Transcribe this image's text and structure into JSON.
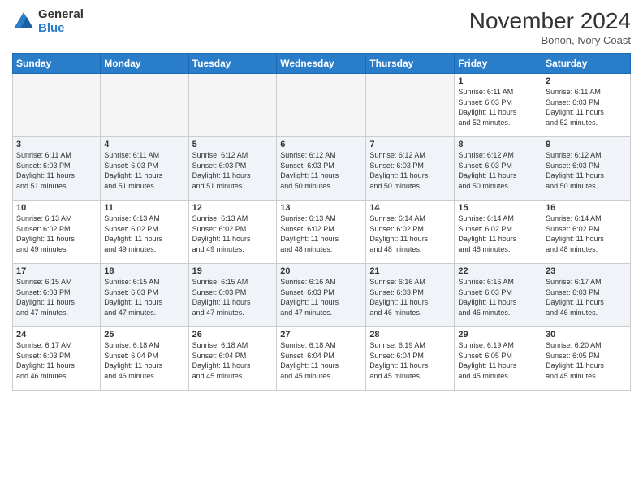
{
  "app": {
    "logo_general": "General",
    "logo_blue": "Blue"
  },
  "header": {
    "month": "November 2024",
    "location": "Bonon, Ivory Coast"
  },
  "weekdays": [
    "Sunday",
    "Monday",
    "Tuesday",
    "Wednesday",
    "Thursday",
    "Friday",
    "Saturday"
  ],
  "weeks": [
    [
      {
        "day": "",
        "info": ""
      },
      {
        "day": "",
        "info": ""
      },
      {
        "day": "",
        "info": ""
      },
      {
        "day": "",
        "info": ""
      },
      {
        "day": "",
        "info": ""
      },
      {
        "day": "1",
        "info": "Sunrise: 6:11 AM\nSunset: 6:03 PM\nDaylight: 11 hours\nand 52 minutes."
      },
      {
        "day": "2",
        "info": "Sunrise: 6:11 AM\nSunset: 6:03 PM\nDaylight: 11 hours\nand 52 minutes."
      }
    ],
    [
      {
        "day": "3",
        "info": "Sunrise: 6:11 AM\nSunset: 6:03 PM\nDaylight: 11 hours\nand 51 minutes."
      },
      {
        "day": "4",
        "info": "Sunrise: 6:11 AM\nSunset: 6:03 PM\nDaylight: 11 hours\nand 51 minutes."
      },
      {
        "day": "5",
        "info": "Sunrise: 6:12 AM\nSunset: 6:03 PM\nDaylight: 11 hours\nand 51 minutes."
      },
      {
        "day": "6",
        "info": "Sunrise: 6:12 AM\nSunset: 6:03 PM\nDaylight: 11 hours\nand 50 minutes."
      },
      {
        "day": "7",
        "info": "Sunrise: 6:12 AM\nSunset: 6:03 PM\nDaylight: 11 hours\nand 50 minutes."
      },
      {
        "day": "8",
        "info": "Sunrise: 6:12 AM\nSunset: 6:03 PM\nDaylight: 11 hours\nand 50 minutes."
      },
      {
        "day": "9",
        "info": "Sunrise: 6:12 AM\nSunset: 6:03 PM\nDaylight: 11 hours\nand 50 minutes."
      }
    ],
    [
      {
        "day": "10",
        "info": "Sunrise: 6:13 AM\nSunset: 6:02 PM\nDaylight: 11 hours\nand 49 minutes."
      },
      {
        "day": "11",
        "info": "Sunrise: 6:13 AM\nSunset: 6:02 PM\nDaylight: 11 hours\nand 49 minutes."
      },
      {
        "day": "12",
        "info": "Sunrise: 6:13 AM\nSunset: 6:02 PM\nDaylight: 11 hours\nand 49 minutes."
      },
      {
        "day": "13",
        "info": "Sunrise: 6:13 AM\nSunset: 6:02 PM\nDaylight: 11 hours\nand 48 minutes."
      },
      {
        "day": "14",
        "info": "Sunrise: 6:14 AM\nSunset: 6:02 PM\nDaylight: 11 hours\nand 48 minutes."
      },
      {
        "day": "15",
        "info": "Sunrise: 6:14 AM\nSunset: 6:02 PM\nDaylight: 11 hours\nand 48 minutes."
      },
      {
        "day": "16",
        "info": "Sunrise: 6:14 AM\nSunset: 6:02 PM\nDaylight: 11 hours\nand 48 minutes."
      }
    ],
    [
      {
        "day": "17",
        "info": "Sunrise: 6:15 AM\nSunset: 6:03 PM\nDaylight: 11 hours\nand 47 minutes."
      },
      {
        "day": "18",
        "info": "Sunrise: 6:15 AM\nSunset: 6:03 PM\nDaylight: 11 hours\nand 47 minutes."
      },
      {
        "day": "19",
        "info": "Sunrise: 6:15 AM\nSunset: 6:03 PM\nDaylight: 11 hours\nand 47 minutes."
      },
      {
        "day": "20",
        "info": "Sunrise: 6:16 AM\nSunset: 6:03 PM\nDaylight: 11 hours\nand 47 minutes."
      },
      {
        "day": "21",
        "info": "Sunrise: 6:16 AM\nSunset: 6:03 PM\nDaylight: 11 hours\nand 46 minutes."
      },
      {
        "day": "22",
        "info": "Sunrise: 6:16 AM\nSunset: 6:03 PM\nDaylight: 11 hours\nand 46 minutes."
      },
      {
        "day": "23",
        "info": "Sunrise: 6:17 AM\nSunset: 6:03 PM\nDaylight: 11 hours\nand 46 minutes."
      }
    ],
    [
      {
        "day": "24",
        "info": "Sunrise: 6:17 AM\nSunset: 6:03 PM\nDaylight: 11 hours\nand 46 minutes."
      },
      {
        "day": "25",
        "info": "Sunrise: 6:18 AM\nSunset: 6:04 PM\nDaylight: 11 hours\nand 46 minutes."
      },
      {
        "day": "26",
        "info": "Sunrise: 6:18 AM\nSunset: 6:04 PM\nDaylight: 11 hours\nand 45 minutes."
      },
      {
        "day": "27",
        "info": "Sunrise: 6:18 AM\nSunset: 6:04 PM\nDaylight: 11 hours\nand 45 minutes."
      },
      {
        "day": "28",
        "info": "Sunrise: 6:19 AM\nSunset: 6:04 PM\nDaylight: 11 hours\nand 45 minutes."
      },
      {
        "day": "29",
        "info": "Sunrise: 6:19 AM\nSunset: 6:05 PM\nDaylight: 11 hours\nand 45 minutes."
      },
      {
        "day": "30",
        "info": "Sunrise: 6:20 AM\nSunset: 6:05 PM\nDaylight: 11 hours\nand 45 minutes."
      }
    ]
  ]
}
